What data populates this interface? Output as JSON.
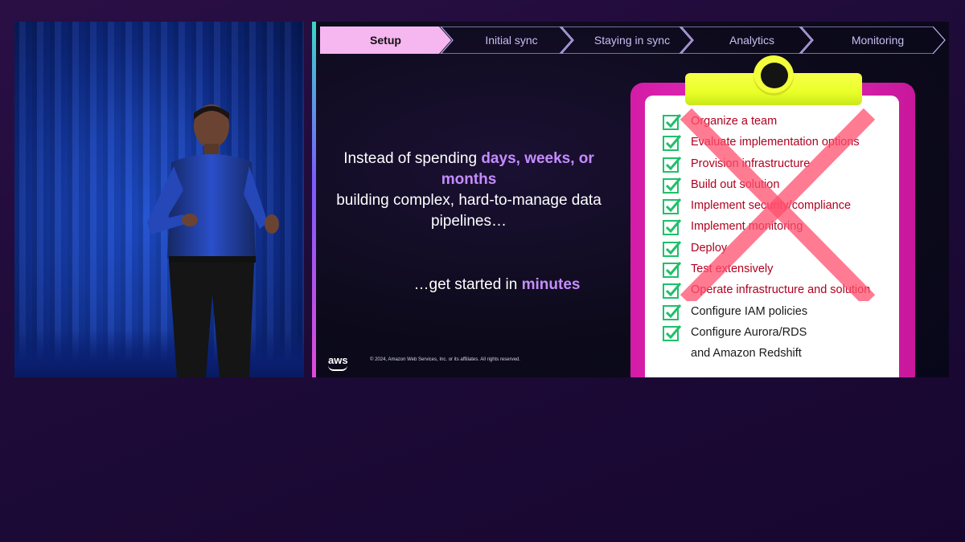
{
  "progress_steps": [
    {
      "label": "Setup",
      "active": true
    },
    {
      "label": "Initial sync",
      "active": false
    },
    {
      "label": "Staying in sync",
      "active": false
    },
    {
      "label": "Analytics",
      "active": false
    },
    {
      "label": "Monitoring",
      "active": false
    }
  ],
  "headline": {
    "part1": "Instead of spending ",
    "highlight": "days, weeks, or months",
    "part2": "building complex, hard-to-manage data pipelines…"
  },
  "subline": {
    "part1": "…get started in ",
    "highlight": "minutes"
  },
  "footer": {
    "logo": "aws",
    "copyright": "© 2024, Amazon Web Services, Inc. or its affiliates. All rights reserved."
  },
  "checklist": {
    "struck_items": [
      "Organize a team",
      "Evaluate implementation options",
      "Provision infrastructure",
      "Build out solution",
      "Implement security/compliance",
      "Implement monitoring",
      "Deploy",
      "Test extensively",
      "Operate infrastructure and solution"
    ],
    "kept_items": [
      {
        "line1": "Configure IAM policies",
        "line2": ""
      },
      {
        "line1": "Configure Aurora/RDS",
        "line2": "and Amazon Redshift"
      }
    ]
  },
  "colors": {
    "highlight": "#c58cff",
    "active_step": "#f6b6f0",
    "clipboard": "#d41ca7",
    "check": "#1fc06a",
    "cross": "#ff4f6e"
  }
}
